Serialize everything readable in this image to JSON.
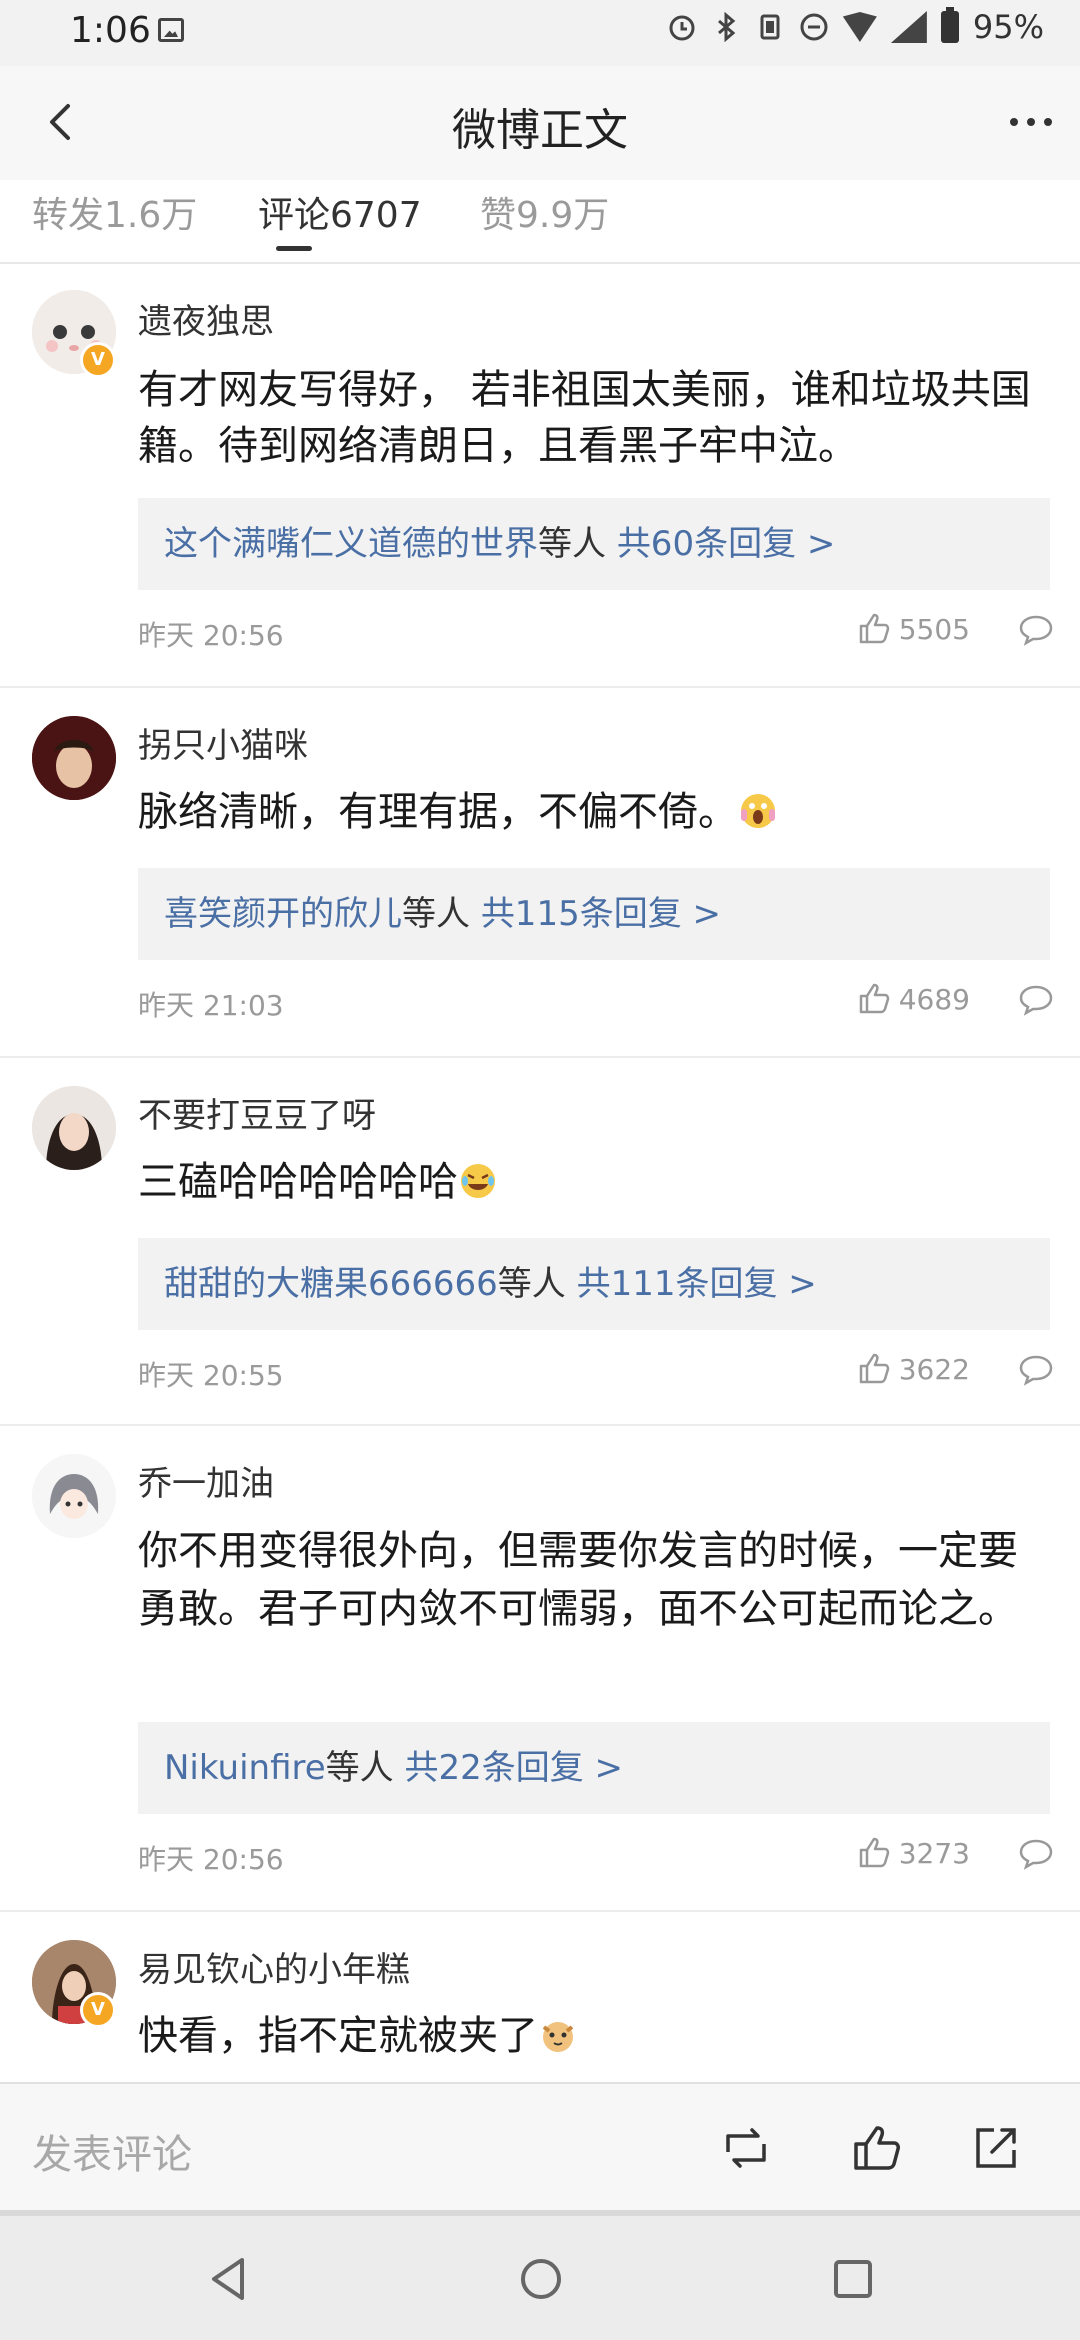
{
  "status_bar": {
    "time": "1:06",
    "battery": "95%"
  },
  "header": {
    "title": "微博正文"
  },
  "tabs": [
    {
      "label": "转发1.6万"
    },
    {
      "label": "评论6707"
    },
    {
      "label": "赞9.9万"
    }
  ],
  "comments": [
    {
      "user": "遗夜独思",
      "text": "有才网友写得好， 若非祖国太美丽，谁和垃圾共国籍。待到网络清朗日，且看黑子牢中泣。",
      "reply_name": "这个满嘴仁义道德的世界",
      "reply_mid": "等人",
      "reply_count": "共60条回复 >",
      "time": "昨天 20:56",
      "likes": "5505",
      "verified": true
    },
    {
      "user": "拐只小猫咪",
      "text": "脉络清晰，有理有据，不偏不倚。",
      "reply_name": "喜笑颜开的欣儿",
      "reply_mid": "等人",
      "reply_count": "共115条回复 >",
      "time": "昨天 21:03",
      "likes": "4689",
      "verified": false
    },
    {
      "user": "不要打豆豆了呀",
      "text": "三磕哈哈哈哈哈哈",
      "reply_name": "甜甜的大糖果666666",
      "reply_mid": "等人",
      "reply_count": "共111条回复 >",
      "time": "昨天 20:55",
      "likes": "3622",
      "verified": false
    },
    {
      "user": "乔一加油",
      "text": "你不用变得很外向，但需要你发言的时候，一定要勇敢。君子可内敛不可懦弱，面不公可起而论之。",
      "reply_name": "Nikuinfire",
      "reply_mid": "等人",
      "reply_count": "共22条回复 >",
      "time": "昨天 20:56",
      "likes": "3273",
      "verified": false
    },
    {
      "user": "易见钦心的小年糕",
      "text": "快看，指不定就被夹了",
      "verified": true
    }
  ],
  "action_bar": {
    "comment_placeholder": "发表评论"
  }
}
